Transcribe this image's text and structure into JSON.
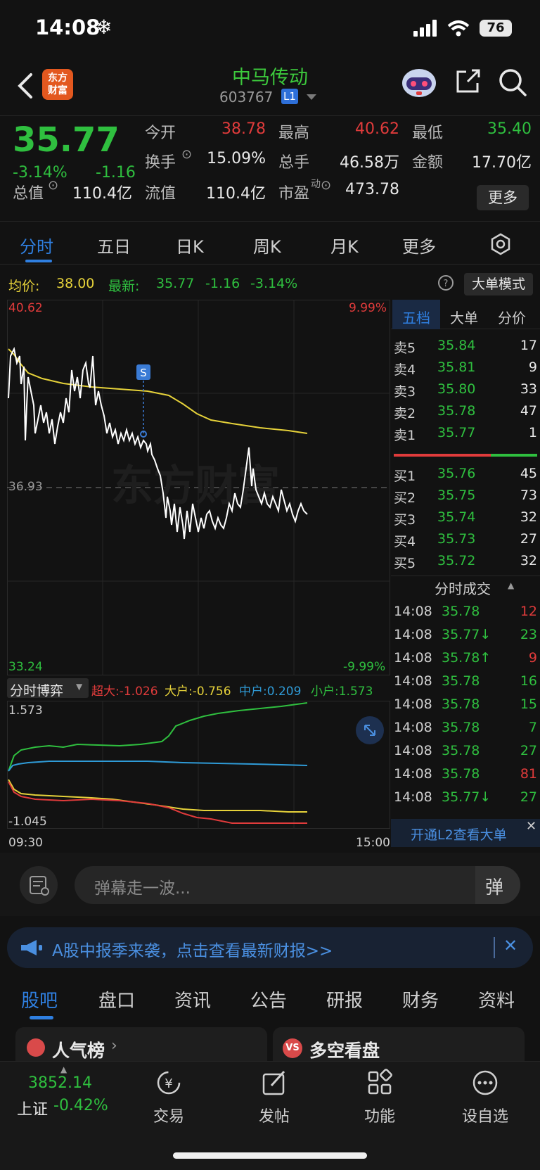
{
  "status": {
    "time": "14:08",
    "battery": "76"
  },
  "header": {
    "logo_text": "东方财富",
    "name": "中马传动",
    "code": "603767",
    "level": "L1"
  },
  "quote": {
    "price": "35.77",
    "pct": "-3.14%",
    "chg": "-1.16",
    "open_label": "今开",
    "open": "38.78",
    "high_label": "最高",
    "high": "40.62",
    "low_label": "最低",
    "low": "35.40",
    "turnover_label": "换手",
    "turnover": "15.09%",
    "volume_label": "总手",
    "volume": "46.58万",
    "amount_label": "金额",
    "amount": "17.70亿",
    "mktcap_label": "总值",
    "mktcap": "110.4亿",
    "float_label": "流值",
    "float": "110.4亿",
    "pe_label": "市盈",
    "pe_sup": "动",
    "pe": "473.78",
    "more": "更多"
  },
  "tabs": [
    "分时",
    "五日",
    "日K",
    "周K",
    "月K",
    "更多"
  ],
  "info": {
    "avg_label": "均价:",
    "avg": "38.00",
    "latest_label": "最新:",
    "latest": "35.77",
    "latest_chg": "-1.16",
    "latest_pct": "-3.14%",
    "big_order_btn": "大单模式"
  },
  "chart_labels": {
    "top_price": "40.62",
    "top_pct": "9.99%",
    "mid_price": "36.93",
    "bottom_price": "33.24",
    "bottom_pct": "-9.99%",
    "watermark": "东方财富",
    "marker": "S"
  },
  "flow": {
    "title": "分时博弈",
    "super_label": "超大:-1.026",
    "big_label": "大户:-0.756",
    "mid_label": "中户:0.209",
    "small_label": "小户:1.573",
    "top": "1.573",
    "bottom": "-1.045",
    "start_time": "09:30",
    "end_time": "15:00"
  },
  "orderbook": {
    "tabs": [
      "五档",
      "大单",
      "分价"
    ],
    "asks": [
      {
        "label": "卖5",
        "price": "35.84",
        "vol": "17"
      },
      {
        "label": "卖4",
        "price": "35.81",
        "vol": "9"
      },
      {
        "label": "卖3",
        "price": "35.80",
        "vol": "33"
      },
      {
        "label": "卖2",
        "price": "35.78",
        "vol": "47"
      },
      {
        "label": "卖1",
        "price": "35.77",
        "vol": "1"
      }
    ],
    "bids": [
      {
        "label": "买1",
        "price": "35.76",
        "vol": "45"
      },
      {
        "label": "买2",
        "price": "35.75",
        "vol": "73"
      },
      {
        "label": "买3",
        "price": "35.74",
        "vol": "32"
      },
      {
        "label": "买4",
        "price": "35.73",
        "vol": "27"
      },
      {
        "label": "买5",
        "price": "35.72",
        "vol": "32"
      }
    ],
    "trades_title": "分时成交",
    "trades": [
      {
        "time": "14:08",
        "price": "35.78",
        "vol": "12",
        "dir": "",
        "color": "red"
      },
      {
        "time": "14:08",
        "price": "35.77↓",
        "vol": "23",
        "dir": "down",
        "color": "green"
      },
      {
        "time": "14:08",
        "price": "35.78↑",
        "vol": "9",
        "dir": "up",
        "color": "red"
      },
      {
        "time": "14:08",
        "price": "35.78",
        "vol": "16",
        "dir": "",
        "color": "green"
      },
      {
        "time": "14:08",
        "price": "35.78",
        "vol": "15",
        "dir": "",
        "color": "green"
      },
      {
        "time": "14:08",
        "price": "35.78",
        "vol": "7",
        "dir": "",
        "color": "green"
      },
      {
        "time": "14:08",
        "price": "35.78",
        "vol": "27",
        "dir": "",
        "color": "green"
      },
      {
        "time": "14:08",
        "price": "35.78",
        "vol": "81",
        "dir": "",
        "color": "red"
      },
      {
        "time": "14:08",
        "price": "35.77↓",
        "vol": "27",
        "dir": "down",
        "color": "green"
      }
    ],
    "l2_promo": "开通L2查看大单"
  },
  "danmu": {
    "placeholder": "弹幕走一波..."
  },
  "banner": {
    "text": "A股中报季来袭，点击查看最新财报>>"
  },
  "bottom_tabs": [
    "股吧",
    "盘口",
    "资讯",
    "公告",
    "研报",
    "财务",
    "资料"
  ],
  "cards": {
    "left": "人气榜",
    "right": "多空看盘"
  },
  "nav": {
    "index_value": "3852.14",
    "index_name": "上证",
    "index_pct": "-0.42%",
    "items": [
      "交易",
      "发帖",
      "功能",
      "设自选"
    ]
  },
  "colors": {
    "up": "#e03b3b",
    "down": "#2fbf3f",
    "avg_line": "#e6d23a",
    "accent": "#2f7fe0"
  }
}
